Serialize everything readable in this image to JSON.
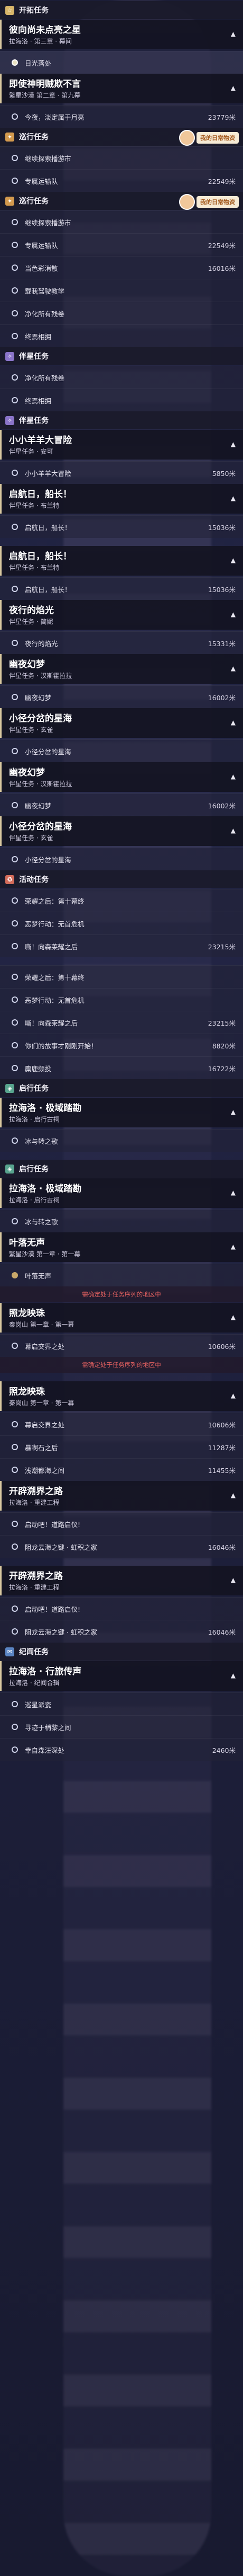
{
  "sections": [
    {
      "type": "cat",
      "label": "开拓任务",
      "color": "#d8b66a",
      "icon": "☆"
    },
    {
      "type": "quest",
      "title": "彼向尚未点亮之星",
      "sub": "拉海洛 · 第三章 · 幕间",
      "chev": "▲"
    },
    {
      "type": "step",
      "text": "日光落处",
      "dist": "",
      "ring": "sel",
      "active": true
    },
    {
      "type": "quest",
      "title": "即使神明贼欺不言",
      "sub": "繁星沙漠 第二章 · 第九幕",
      "chev": "▲"
    },
    {
      "type": "step",
      "text": "今夜，淡定属于月亮",
      "dist": "23779米",
      "ring": ""
    },
    {
      "type": "cat",
      "label": "巡行任务",
      "color": "#d39a4e",
      "icon": "✦",
      "mascot": "我的日常物资"
    },
    {
      "type": "step",
      "text": "继续探索播游市",
      "dist": "",
      "ring": ""
    },
    {
      "type": "step",
      "text": "专属运输队",
      "dist": "22549米",
      "ring": ""
    },
    {
      "type": "cat",
      "label": "巡行任务",
      "color": "#d39a4e",
      "icon": "✦",
      "mascot": "我的日常物资"
    },
    {
      "type": "step",
      "text": "继续探索播游市",
      "dist": "",
      "ring": ""
    },
    {
      "type": "step",
      "text": "专属运输队",
      "dist": "22549米",
      "ring": ""
    },
    {
      "type": "step",
      "text": "当色彩消散",
      "dist": "16016米",
      "ring": ""
    },
    {
      "type": "step",
      "text": "载我驾驶教学",
      "dist": "",
      "ring": ""
    },
    {
      "type": "step",
      "text": "净化所有残卷",
      "dist": "",
      "ring": ""
    },
    {
      "type": "step",
      "text": "终焉相拥",
      "dist": "",
      "ring": ""
    },
    {
      "type": "cat",
      "label": "伴星任务",
      "color": "#8a74c9",
      "icon": "✧"
    },
    {
      "type": "step",
      "text": "净化所有残卷",
      "dist": "",
      "ring": ""
    },
    {
      "type": "step",
      "text": "终焉相拥",
      "dist": "",
      "ring": ""
    },
    {
      "type": "cat",
      "label": "伴星任务",
      "color": "#8a74c9",
      "icon": "✧"
    },
    {
      "type": "quest",
      "title": "小小羊羊大冒险",
      "sub": "伴星任务 · 安可",
      "chev": "▲"
    },
    {
      "type": "step",
      "text": "小小羊羊大冒险",
      "dist": "5850米",
      "ring": ""
    },
    {
      "type": "quest",
      "title": "启航日，船长！",
      "sub": "伴星任务 · 布兰特",
      "chev": "▲"
    },
    {
      "type": "step",
      "text": "启航日，船长！",
      "dist": "15036米",
      "ring": ""
    },
    {
      "type": "gap"
    },
    {
      "type": "quest",
      "title": "启航日，船长！",
      "sub": "伴星任务 · 布兰特",
      "chev": "▲"
    },
    {
      "type": "step",
      "text": "启航日，船长！",
      "dist": "15036米",
      "ring": ""
    },
    {
      "type": "quest",
      "title": "夜行的焰光",
      "sub": "伴星任务 · 简妮",
      "chev": "▲"
    },
    {
      "type": "step",
      "text": "夜行的焰光",
      "dist": "15331米",
      "ring": ""
    },
    {
      "type": "quest",
      "title": "幽夜幻梦",
      "sub": "伴星任务 · 汉斯霍拉拉",
      "chev": "▲"
    },
    {
      "type": "step",
      "text": "幽夜幻梦",
      "dist": "16002米",
      "ring": ""
    },
    {
      "type": "quest",
      "title": "小径分岔的星海",
      "sub": "伴星任务 · 玄雀",
      "chev": "▲"
    },
    {
      "type": "step",
      "text": "小径分岔的星海",
      "dist": "",
      "ring": ""
    },
    {
      "type": "quest",
      "title": "幽夜幻梦",
      "sub": "伴星任务 · 汉斯霍拉拉",
      "chev": "▲"
    },
    {
      "type": "step",
      "text": "幽夜幻梦",
      "dist": "16002米",
      "ring": ""
    },
    {
      "type": "quest",
      "title": "小径分岔的星海",
      "sub": "伴星任务 · 玄雀",
      "chev": "▲"
    },
    {
      "type": "step",
      "text": "小径分岔的星海",
      "dist": "",
      "ring": ""
    },
    {
      "type": "cat",
      "label": "活动任务",
      "color": "#d36c5a",
      "icon": "✪"
    },
    {
      "type": "step",
      "text": "荣耀之后：第十幕终",
      "dist": "",
      "ring": ""
    },
    {
      "type": "step",
      "text": "恶梦行动：无首危机",
      "dist": "",
      "ring": ""
    },
    {
      "type": "step",
      "text": "嘶！向森莱耀之后",
      "dist": "23215米",
      "ring": ""
    },
    {
      "type": "gap"
    },
    {
      "type": "step",
      "text": "荣耀之后：第十幕终",
      "dist": "",
      "ring": ""
    },
    {
      "type": "step",
      "text": "恶梦行动：无首危机",
      "dist": "",
      "ring": ""
    },
    {
      "type": "step",
      "text": "嘶！向森莱耀之后",
      "dist": "23215米",
      "ring": ""
    },
    {
      "type": "step",
      "text": "你们的故事才刚刚开始！",
      "dist": "8820米",
      "ring": ""
    },
    {
      "type": "step",
      "text": "麋鹿频投",
      "dist": "16722米",
      "ring": ""
    },
    {
      "type": "cat",
      "label": "启行任务",
      "color": "#58a48e",
      "icon": "◈"
    },
    {
      "type": "quest",
      "title": "拉海洛 · 极域踏勘",
      "sub": "拉海洛 · 启行古祠",
      "chev": "▲"
    },
    {
      "type": "step",
      "text": "冰与转之歌",
      "dist": "",
      "ring": ""
    },
    {
      "type": "gap"
    },
    {
      "type": "cat",
      "label": "启行任务",
      "color": "#58a48e",
      "icon": "◈"
    },
    {
      "type": "quest",
      "title": "拉海洛 · 极域踏勘",
      "sub": "拉海洛 · 启行古祠",
      "chev": "▲"
    },
    {
      "type": "step",
      "text": "冰与转之歌",
      "dist": "",
      "ring": ""
    },
    {
      "type": "quest",
      "title": "叶落无声",
      "sub": "繁星沙漠 第一章 · 第一幕",
      "chev": "▲"
    },
    {
      "type": "step",
      "text": "叶落无声",
      "dist": "",
      "ring": "done"
    },
    {
      "type": "warn",
      "text": "需确定处于任务序列的地区中"
    },
    {
      "type": "quest",
      "title": "照龙映珠",
      "sub": "秦岗山 第一章 · 第一幕",
      "chev": "▲"
    },
    {
      "type": "step",
      "text": "幕启交界之处",
      "dist": "10606米",
      "ring": ""
    },
    {
      "type": "warn",
      "text": "需确定处于任务序列的地区中"
    },
    {
      "type": "gap"
    },
    {
      "type": "quest",
      "title": "照龙映珠",
      "sub": "秦岗山 第一章 · 第一幕",
      "chev": "▲"
    },
    {
      "type": "step",
      "text": "幕启交界之处",
      "dist": "10606米",
      "ring": ""
    },
    {
      "type": "step",
      "text": "暴啊石之后",
      "dist": "11287米",
      "ring": ""
    },
    {
      "type": "step",
      "text": "浅潮都海之间",
      "dist": "11455米",
      "ring": ""
    },
    {
      "type": "quest",
      "title": "开辟溯界之路",
      "sub": "拉海洛 · 重建工程",
      "chev": "▲"
    },
    {
      "type": "step",
      "text": "启动吧！道路启仪!",
      "dist": "",
      "ring": ""
    },
    {
      "type": "step",
      "text": "阻龙云海之键 · 虹积之家",
      "dist": "16046米",
      "ring": ""
    },
    {
      "type": "gap"
    },
    {
      "type": "quest",
      "title": "开辟溯界之路",
      "sub": "拉海洛 · 重建工程",
      "chev": "▲"
    },
    {
      "type": "step",
      "text": "启动吧！道路启仪!",
      "dist": "",
      "ring": ""
    },
    {
      "type": "step",
      "text": "阻龙云海之键 · 虹积之家",
      "dist": "16046米",
      "ring": ""
    },
    {
      "type": "cat",
      "label": "纪闻任务",
      "color": "#5b86c4",
      "icon": "✉"
    },
    {
      "type": "quest",
      "title": "拉海洛 · 行旅传声",
      "sub": "拉海洛 · 纪闻合辑",
      "chev": "▲"
    },
    {
      "type": "step",
      "text": "巡星派瓷",
      "dist": "",
      "ring": ""
    },
    {
      "type": "step",
      "text": "寻迹于稍黎之间",
      "dist": "",
      "ring": ""
    },
    {
      "type": "step",
      "text": "幸自森汪深处",
      "dist": "2460米",
      "ring": ""
    }
  ]
}
